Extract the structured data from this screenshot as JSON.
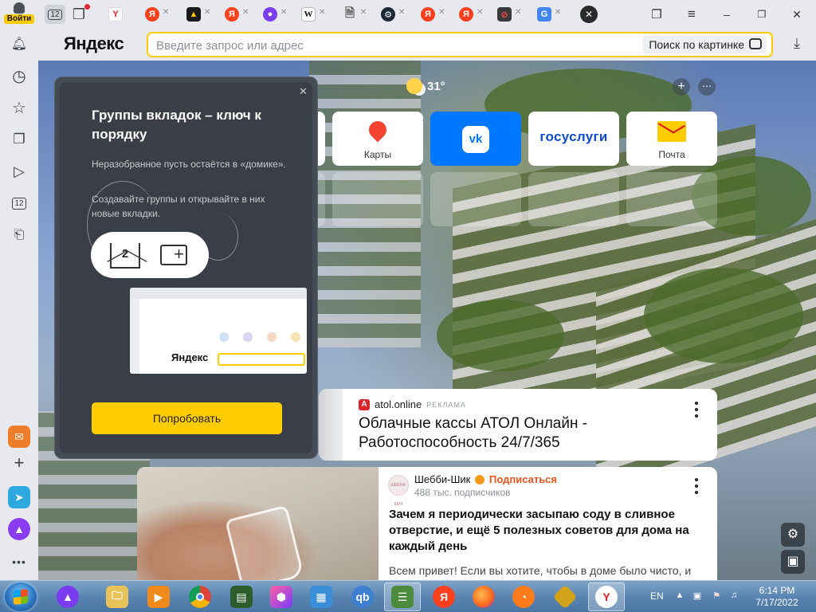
{
  "sidebar": {
    "login_label": "Войти",
    "tabs_count": "12"
  },
  "tabbar": {
    "tab_groups_count": "12"
  },
  "address": {
    "logo": "Яндекс",
    "placeholder": "Введите запрос или адрес",
    "image_search_label": "Поиск по картинке"
  },
  "weather": {
    "temperature": "31°"
  },
  "tiles": [
    {
      "name": "Карты"
    },
    {
      "name": "VK"
    },
    {
      "name": "госуслуги"
    },
    {
      "name": "Почта"
    }
  ],
  "promo": {
    "title": "Группы вкладок – ключ к порядку",
    "text1": "Неразобранное пусть остаётся в «домике».",
    "text2": "Создавайте группы и открывайте в них новые вкладки.",
    "pill_home_count": "2",
    "preview_logo": "Яндекс",
    "button": "Попробовать"
  },
  "ad_card": {
    "source": "atol.online",
    "tag": "РЕКЛАМА",
    "title": "Облачные кассы АТОЛ Онлайн - Работоспособность 24/7/365"
  },
  "zen_card": {
    "avatar_text": "ШЕББИ-ШИК",
    "author": "Шебби-Шик",
    "subscribe_label": "Подписаться",
    "subscribers": "488 тыс. подписчиков",
    "title": "Зачем я периодически засыпаю соду в сливное отверстие, и ещё 5 полезных советов для дома на каждый день",
    "snippet": "Всем привет! Если вы хотите, чтобы в доме было чисто, и"
  },
  "taskbar": {
    "language": "EN",
    "time": "6:14 PM",
    "date": "7/17/2022"
  },
  "colors": {
    "accent_yellow": "#ffcc00",
    "vk_blue": "#0077ff",
    "zen_subscribe": "#e8541d"
  }
}
